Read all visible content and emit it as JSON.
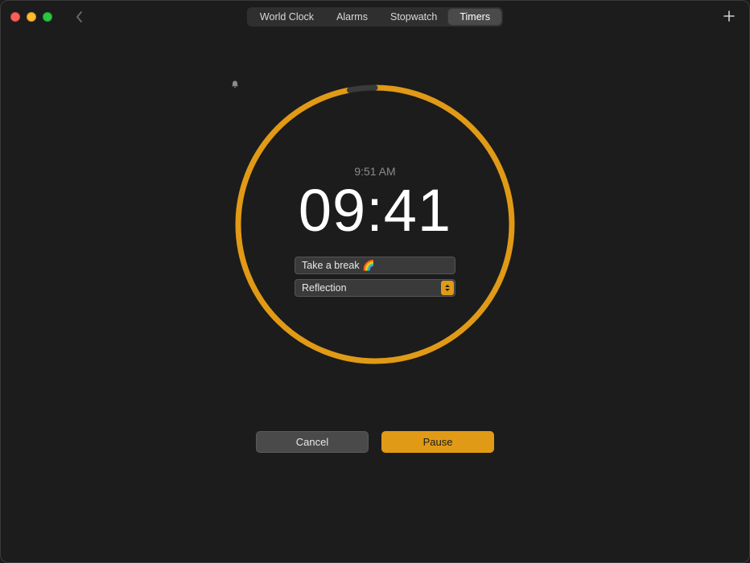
{
  "tabs": [
    {
      "label": "World Clock",
      "active": false
    },
    {
      "label": "Alarms",
      "active": false
    },
    {
      "label": "Stopwatch",
      "active": false
    },
    {
      "label": "Timers",
      "active": true
    }
  ],
  "timer": {
    "end_time": "9:51 AM",
    "remaining": "09:41",
    "label_value": "Take a break 🌈",
    "sound_value": "Reflection",
    "progress_fraction": 0.03
  },
  "buttons": {
    "cancel": "Cancel",
    "pause": "Pause"
  },
  "colors": {
    "accent": "#e19a16",
    "track": "#3a3a3a"
  }
}
